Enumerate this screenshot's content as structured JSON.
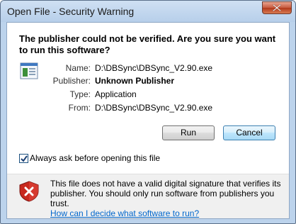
{
  "window": {
    "title": "Open File - Security Warning"
  },
  "dialog": {
    "heading": "The publisher could not be verified.  Are you sure you want to run this software?",
    "fields": [
      {
        "label": "Name:",
        "value": "D:\\DBSync\\DBSync_V2.90.exe",
        "bold": false
      },
      {
        "label": "Publisher:",
        "value": "Unknown Publisher",
        "bold": true
      },
      {
        "label": "Type:",
        "value": "Application",
        "bold": false
      },
      {
        "label": "From:",
        "value": "D:\\DBSync\\DBSync_V2.90.exe",
        "bold": false
      }
    ],
    "run_label": "Run",
    "cancel_label": "Cancel",
    "checkbox": {
      "label": "Always ask before opening this file",
      "checked": true
    },
    "warning_text": "This file does not have a valid digital signature that verifies its publisher.  You should only run software from publishers you trust.",
    "help_link": "How can I decide what software to run?"
  },
  "colors": {
    "link": "#0066cc",
    "warning_icon": "#c8281e",
    "close_button": "#c65a3f"
  },
  "icons": {
    "close": "close-icon",
    "file": "application-file-icon",
    "warning": "shield-warning-icon",
    "check": "checkmark-icon"
  }
}
